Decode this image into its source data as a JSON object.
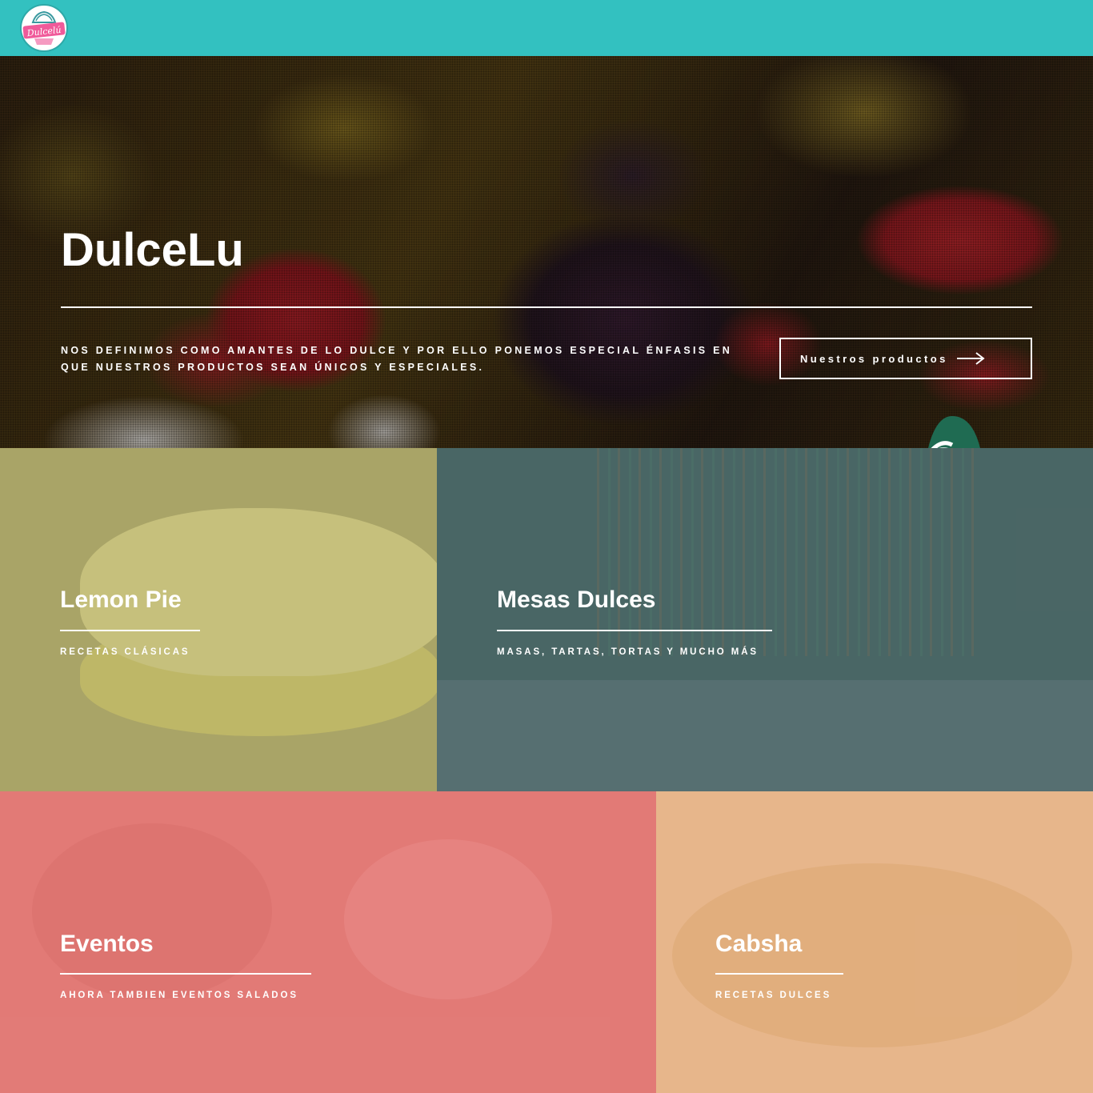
{
  "header": {
    "logo_text": "Dulcelú",
    "brand_color": "#33c1c0"
  },
  "hero": {
    "title": "DulceLu",
    "text": "Nos definimos como amantes de lo dulce y por ello ponemos especial énfasis en que nuestros productos sean únicos y especiales.",
    "button_label": "Nuestros productos",
    "button_icon": "arrow-right-icon"
  },
  "tiles": [
    {
      "title": "Lemon Pie",
      "subtitle": "Recetas clásicas",
      "color": "#a8a46b"
    },
    {
      "title": "Mesas Dulces",
      "subtitle": "Masas, tartas, tortas y mucho más",
      "color": "#4f6a69"
    },
    {
      "title": "Eventos",
      "subtitle": "Ahora tambien eventos salados",
      "color": "#e27b77"
    },
    {
      "title": "Cabsha",
      "subtitle": "Recetas dulces",
      "color": "#e7b58a"
    }
  ]
}
